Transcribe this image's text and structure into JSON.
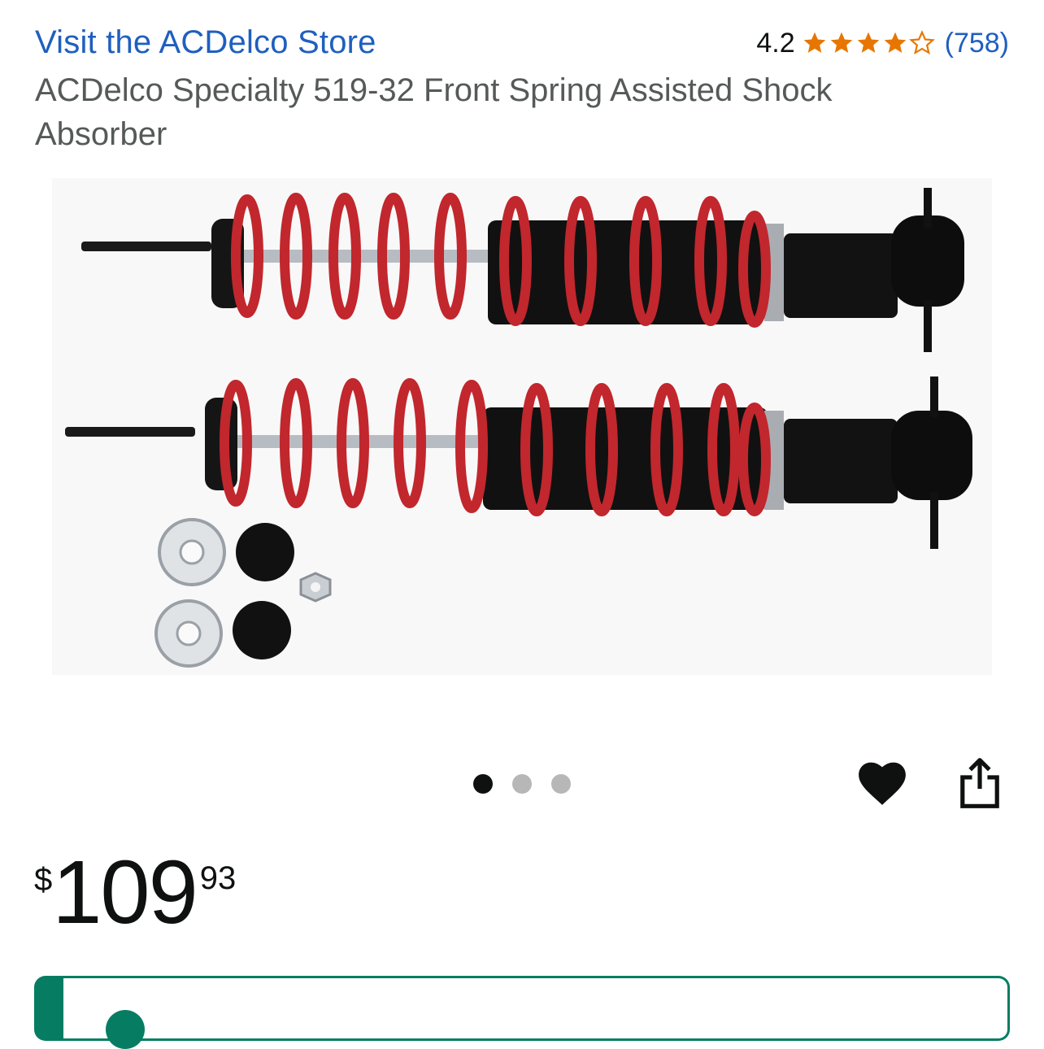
{
  "store": {
    "link_label": "Visit the ACDelco Store"
  },
  "rating": {
    "value": "4.2",
    "stars": 4.2,
    "count": "(758)",
    "star_color": "#e77600"
  },
  "product": {
    "title": "ACDelco Specialty 519-32 Front Spring Assisted Shock Absorber"
  },
  "gallery": {
    "image_count": 3,
    "active_index": 0
  },
  "actions": {
    "wishlist_icon": "heart-icon",
    "share_icon": "share-icon"
  },
  "price": {
    "symbol": "$",
    "whole": "109",
    "fraction": "93"
  },
  "colors": {
    "link": "#1f5fbf",
    "accent_green": "#067d62",
    "spring_red": "#c1272d"
  }
}
